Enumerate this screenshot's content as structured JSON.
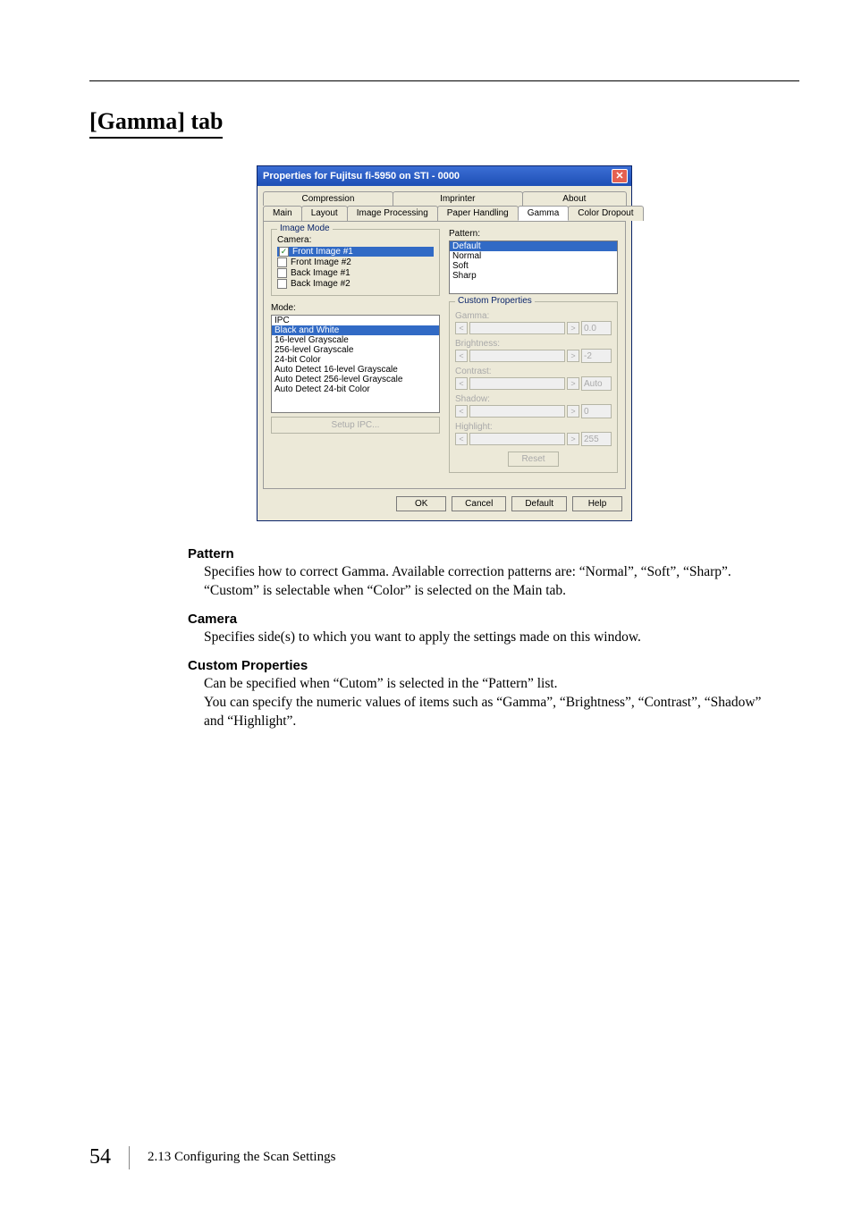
{
  "section_title": "[Gamma] tab",
  "dialog": {
    "title": "Properties for Fujitsu fi-5950 on STI - 0000",
    "close_glyph": "✕",
    "tabs_row1": [
      "Compression",
      "Imprinter",
      "About"
    ],
    "tabs_row2": [
      "Main",
      "Layout",
      "Image Processing",
      "Paper Handling",
      "Gamma",
      "Color Dropout"
    ],
    "active_tab": "Gamma",
    "image_mode_title": "Image Mode",
    "camera_label": "Camera:",
    "camera_items": [
      {
        "label": "Front Image #1",
        "checked": true,
        "selected": true
      },
      {
        "label": "Front Image #2",
        "checked": false,
        "selected": false
      },
      {
        "label": "Back Image #1",
        "checked": false,
        "selected": false
      },
      {
        "label": "Back Image #2",
        "checked": false,
        "selected": false
      }
    ],
    "mode_label": "Mode:",
    "mode_items": [
      "IPC",
      "Black and White",
      "16-level Grayscale",
      "256-level Grayscale",
      "24-bit Color",
      "Auto Detect 16-level Grayscale",
      "Auto Detect 256-level Grayscale",
      "Auto Detect 24-bit Color"
    ],
    "mode_selected": "Black and White",
    "setup_ipc": "Setup IPC...",
    "pattern_label": "Pattern:",
    "pattern_items": [
      "Default",
      "Normal",
      "Soft",
      "Sharp"
    ],
    "pattern_selected": "Default",
    "custom_props_title": "Custom Properties",
    "cp_gamma": "Gamma:",
    "cp_brightness": "Brightness:",
    "cp_contrast": "Contrast:",
    "cp_shadow": "Shadow:",
    "cp_highlight": "Highlight:",
    "vals": {
      "gamma": "0.0",
      "brightness": "-2",
      "contrast": "Auto",
      "shadow": "0",
      "highlight": "255"
    },
    "arrow_left": "<",
    "arrow_right": ">",
    "reset": "Reset",
    "buttons": {
      "ok": "OK",
      "cancel": "Cancel",
      "default": "Default",
      "help": "Help"
    }
  },
  "text": {
    "h_pattern": "Pattern",
    "p_pattern": "Specifies how to correct Gamma. Available correction patterns are: “Normal”, “Soft”, “Sharp”. “Custom” is selectable when “Color” is selected on the Main tab.",
    "h_camera": "Camera",
    "p_camera": "Specifies side(s) to which you want to apply the settings made on this window.",
    "h_custom": "Custom Properties",
    "p_custom": "Can be specified when “Cutom” is selected in the “Pattern” list.\nYou can specify the numeric values of items such as “Gamma”, “Brightness”, “Contrast”, “Shadow” and “Highlight”."
  },
  "footer": {
    "page": "54",
    "text": "2.13 Configuring the Scan Settings"
  }
}
